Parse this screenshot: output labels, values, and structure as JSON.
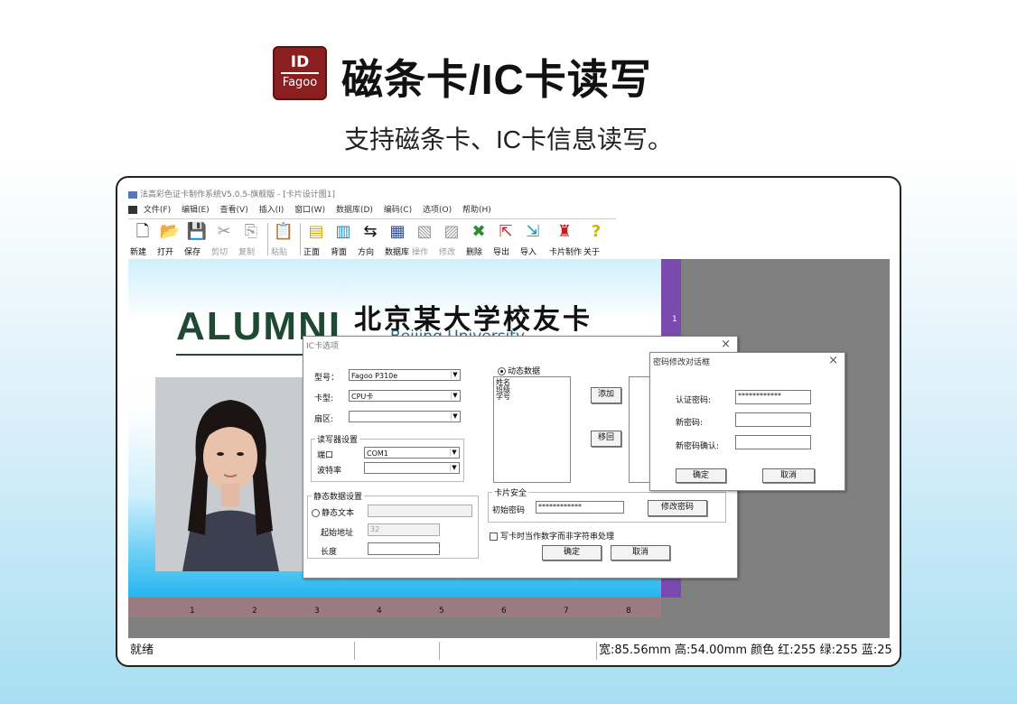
{
  "header": {
    "logo_top": "ID",
    "logo_bottom": "Fagoo",
    "title": "磁条卡/IC卡读写",
    "subtitle": "支持磁条卡、IC卡信息读写。"
  },
  "app": {
    "title": "法高彩色证卡制作系统V5.0.5-旗舰版 - [卡片设计图1]",
    "menu": [
      "文件(F)",
      "编辑(E)",
      "查看(V)",
      "插入(I)",
      "窗口(W)",
      "数据库(D)",
      "编码(C)",
      "选项(O)",
      "帮助(H)"
    ],
    "toolbar": [
      {
        "label": "新建",
        "icon": "new-file-icon",
        "glyph": "🗋"
      },
      {
        "label": "打开",
        "icon": "open-folder-icon",
        "glyph": "📂"
      },
      {
        "label": "保存",
        "icon": "save-icon",
        "glyph": "💾"
      },
      {
        "label": "剪切",
        "icon": "cut-icon",
        "glyph": "✂"
      },
      {
        "label": "复制",
        "icon": "copy-icon",
        "glyph": "⎘"
      },
      {
        "label": "粘贴",
        "icon": "paste-icon",
        "glyph": "📋"
      },
      {
        "label": "正面",
        "icon": "card-front-icon",
        "glyph": "▤"
      },
      {
        "label": "背面",
        "icon": "card-back-icon",
        "glyph": "▥"
      },
      {
        "label": "方向",
        "icon": "orientation-icon",
        "glyph": "⇆"
      },
      {
        "label": "数据库",
        "icon": "database-icon",
        "glyph": "▦"
      },
      {
        "label": "操作",
        "icon": "operate-icon",
        "glyph": "▧"
      },
      {
        "label": "修改",
        "icon": "modify-icon",
        "glyph": "▨"
      },
      {
        "label": "删除",
        "icon": "delete-icon",
        "glyph": "✖"
      },
      {
        "label": "导出",
        "icon": "export-icon",
        "glyph": "⇱"
      },
      {
        "label": "导入",
        "icon": "import-icon",
        "glyph": "⇲"
      },
      {
        "label": "卡片制作",
        "icon": "card-make-icon",
        "glyph": "♜"
      },
      {
        "label": "关于",
        "icon": "about-icon",
        "glyph": "?"
      }
    ],
    "status": {
      "ready": "就绪",
      "info": "宽:85.56mm 高:54.00mm 颜色 红:255  绿:255 蓝:25"
    }
  },
  "card": {
    "alumni": "ALUMNI",
    "school_cn": "北京某大学校友卡",
    "school_en": "Beijing University",
    "ruler_h": [
      "1",
      "2",
      "3",
      "4",
      "5",
      "6",
      "7",
      "8"
    ],
    "ruler_v_mark": "1"
  },
  "ic_dialog": {
    "title": "IC卡选项",
    "model_label": "型号：",
    "model_value": "Fagoo P310e",
    "card_type_label": "卡型:",
    "card_type_value": "CPU卡",
    "sector_label": "扇区:",
    "sector_value": "",
    "reader_group": "读写器设置",
    "port_label": "端口",
    "port_value": "COM1",
    "baud_label": "波特率",
    "baud_value": "",
    "static_group": "静态数据设置",
    "static_text_label": "静态文本",
    "start_addr_label": "起始地址",
    "start_addr_value": "32",
    "length_label": "长度",
    "dynamic_label": "动态数据",
    "dynamic_items": [
      "姓名",
      "班级",
      "学号"
    ],
    "add_label": "添加",
    "remove_label": "移回",
    "security_group": "卡片安全",
    "init_pwd_label": "初始密码",
    "init_pwd_value": "************",
    "change_pwd_label": "修改密码",
    "write_option": "写卡时当作数字而非字符串处理",
    "ok_label": "确定",
    "cancel_label": "取消"
  },
  "pwd_dialog": {
    "title": "密码修改对话框",
    "auth_label": "认证密码:",
    "auth_value": "************",
    "new_label": "新密码:",
    "confirm_label": "新密码确认:",
    "ok_label": "确定",
    "cancel_label": "取消"
  }
}
